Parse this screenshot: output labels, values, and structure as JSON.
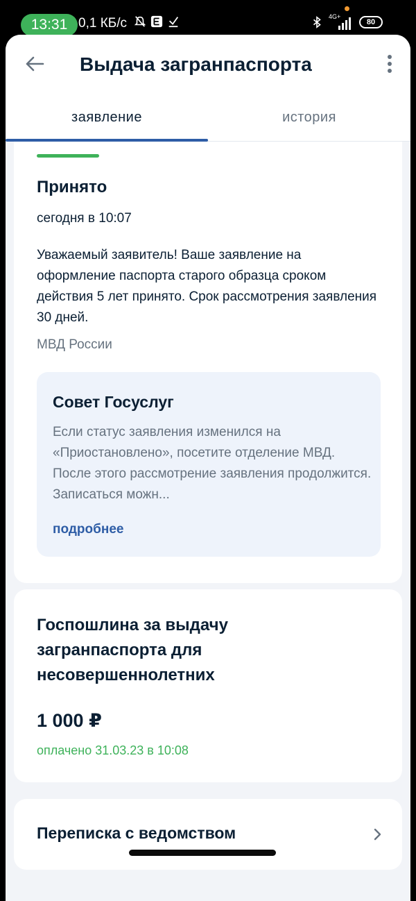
{
  "status_bar": {
    "time": "13:31",
    "net_speed": "0,1 КБ/с",
    "network": "4G+",
    "battery": "80",
    "icons": [
      "bell-off-icon",
      "e-badge-icon",
      "download-icon",
      "bluetooth-icon",
      "signal-icon",
      "battery-icon"
    ]
  },
  "header": {
    "title": "Выдача загранпаспорта",
    "back_icon": "arrow-left-icon",
    "menu_icon": "more-vertical-icon"
  },
  "tabs": [
    {
      "label": "заявление",
      "active": true
    },
    {
      "label": "история",
      "active": false
    }
  ],
  "status_card": {
    "status": "Принято",
    "time": "сегодня в 10:07",
    "message": "Уважаемый заявитель! Ваше заявление на оформление паспорта старого образца сроком действия 5 лет принято. Срок рассмотрения заявления 30 дней.",
    "organization": "МВД России",
    "tip": {
      "title": "Совет Госуслуг",
      "text": "Если статус заявления изменился на «Приостановлено», посетите отделение МВД. После этого рассмотрение заявления продолжится. Записаться можн...",
      "link": "подробнее"
    }
  },
  "fee_card": {
    "title": "Госпошлина за выдачу загранпаспорта для несовершеннолетних",
    "amount": "1 000 ₽",
    "paid": "оплачено 31.03.23 в 10:08"
  },
  "correspondence": {
    "label": "Переписка с ведомством",
    "icon": "chevron-right-icon"
  },
  "colors": {
    "accent_blue": "#2e5da6",
    "success_green": "#3eb25a",
    "text_primary": "#0b1f33",
    "text_secondary": "#66727f",
    "background": "#f2f4f8",
    "tip_background": "#eef3fb"
  }
}
